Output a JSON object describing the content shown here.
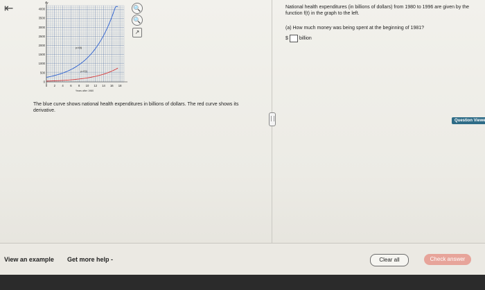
{
  "nav": {
    "back_glyph": "⇤"
  },
  "graph": {
    "y_ticks": [
      "4000",
      "3500",
      "3000",
      "2500",
      "2000",
      "1500",
      "1000",
      "500",
      "0"
    ],
    "x_ticks": [
      "0",
      "2",
      "4",
      "6",
      "8",
      "10",
      "12",
      "14",
      "16",
      "18"
    ],
    "x_axis_label": "Years after 1980",
    "y_axis_arrow_label": "Ay",
    "curve_label_f": "y=f(t)",
    "curve_label_fprime": "y=f'(t)",
    "colors": {
      "blue_curve": "#2a5fcf",
      "red_curve": "#d73a3a",
      "grid": "#4f6fa0"
    }
  },
  "tools": {
    "zoom_in": "🔍",
    "zoom_out": "🔍",
    "external": "↗"
  },
  "caption": "The blue curve shows national health expenditures in billions of dollars. The red curve shows its derivative.",
  "question": {
    "text": "National health expenditures (in billions of dollars) from 1980 to 1996 are given by the function f(t) in the graph to the left.",
    "part": "(a) How much money was being spent at the beginning of 1981?",
    "unit_prefix": "$",
    "unit_suffix": "billion"
  },
  "question_viewer": "Question Viewer",
  "footer": {
    "view_example": "View an example",
    "get_help": "Get more help -",
    "clear_all": "Clear all",
    "check_answer": "Check answer"
  }
}
